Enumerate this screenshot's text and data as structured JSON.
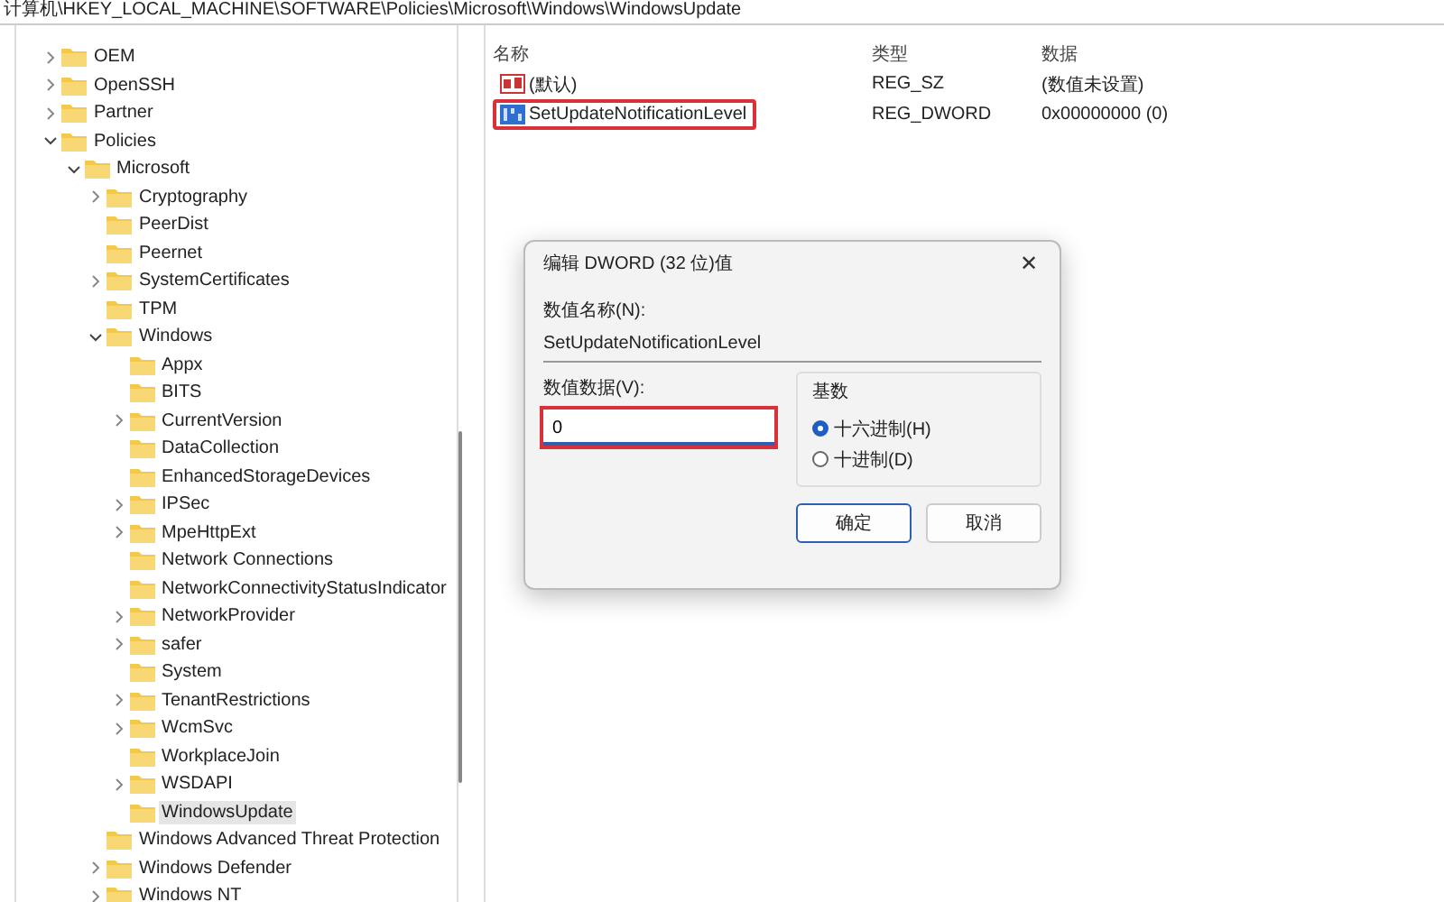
{
  "address_bar": "计算机\\HKEY_LOCAL_MACHINE\\SOFTWARE\\Policies\\Microsoft\\Windows\\WindowsUpdate",
  "tree": {
    "items": [
      {
        "label": "OEM",
        "kind": "branch",
        "selected": false
      },
      {
        "label": "OpenSSH",
        "kind": "branch",
        "selected": false
      },
      {
        "label": "Partner",
        "kind": "branch",
        "selected": false
      },
      {
        "label": "Policies",
        "kind": "branch",
        "selected": false,
        "children": [
          {
            "label": "Microsoft",
            "kind": "branch",
            "selected": false,
            "children": [
              {
                "label": "Cryptography",
                "kind": "branch",
                "selected": false
              },
              {
                "label": "PeerDist",
                "kind": "leaf",
                "selected": false
              },
              {
                "label": "Peernet",
                "kind": "leaf",
                "selected": false
              },
              {
                "label": "SystemCertificates",
                "kind": "branch",
                "selected": false
              },
              {
                "label": "TPM",
                "kind": "leaf",
                "selected": false
              },
              {
                "label": "Windows",
                "kind": "branch",
                "selected": false,
                "children": [
                  {
                    "label": "Appx",
                    "kind": "leaf",
                    "selected": false
                  },
                  {
                    "label": "BITS",
                    "kind": "leaf",
                    "selected": false
                  },
                  {
                    "label": "CurrentVersion",
                    "kind": "branch",
                    "selected": false
                  },
                  {
                    "label": "DataCollection",
                    "kind": "leaf",
                    "selected": false
                  },
                  {
                    "label": "EnhancedStorageDevices",
                    "kind": "leaf",
                    "selected": false
                  },
                  {
                    "label": "IPSec",
                    "kind": "branch",
                    "selected": false
                  },
                  {
                    "label": "MpeHttpExt",
                    "kind": "branch",
                    "selected": false
                  },
                  {
                    "label": "Network Connections",
                    "kind": "leaf",
                    "selected": false
                  },
                  {
                    "label": "NetworkConnectivityStatusIndicator",
                    "kind": "leaf",
                    "selected": false
                  },
                  {
                    "label": "NetworkProvider",
                    "kind": "branch",
                    "selected": false
                  },
                  {
                    "label": "safer",
                    "kind": "branch",
                    "selected": false
                  },
                  {
                    "label": "System",
                    "kind": "leaf",
                    "selected": false
                  },
                  {
                    "label": "TenantRestrictions",
                    "kind": "branch",
                    "selected": false
                  },
                  {
                    "label": "WcmSvc",
                    "kind": "branch",
                    "selected": false
                  },
                  {
                    "label": "WorkplaceJoin",
                    "kind": "leaf",
                    "selected": false
                  },
                  {
                    "label": "WSDAPI",
                    "kind": "branch",
                    "selected": false
                  },
                  {
                    "label": "WindowsUpdate",
                    "kind": "leaf",
                    "selected": true
                  }
                ]
              },
              {
                "label": "Windows Advanced Threat Protection",
                "kind": "leaf",
                "selected": false
              },
              {
                "label": "Windows Defender",
                "kind": "branch",
                "selected": false
              },
              {
                "label": "Windows NT",
                "kind": "branch",
                "selected": false
              }
            ]
          }
        ]
      }
    ]
  },
  "values": {
    "columns": [
      "名称",
      "类型",
      "数据"
    ],
    "rows": [
      {
        "kind": "string",
        "name": "(默认)",
        "type": "REG_SZ",
        "data": "(数值未设置)",
        "outlined": false
      },
      {
        "kind": "dword",
        "name": "SetUpdateNotificationLevel",
        "type": "REG_DWORD",
        "data": "0x00000000 (0)",
        "outlined": true
      }
    ]
  },
  "dialog": {
    "title": "编辑 DWORD (32 位)值",
    "close": "✕",
    "name_label": "数值名称(N):",
    "name_value": "SetUpdateNotificationLevel",
    "data_label": "数值数据(V):",
    "data_value": "0",
    "data_outlined": true,
    "base_label": "基数",
    "base_options": [
      {
        "label": "十六进制(H)",
        "selected": true
      },
      {
        "label": "十进制(D)",
        "selected": false
      }
    ],
    "buttons": [
      {
        "label": "确定",
        "default": true
      },
      {
        "label": "取消",
        "default": false
      }
    ]
  }
}
